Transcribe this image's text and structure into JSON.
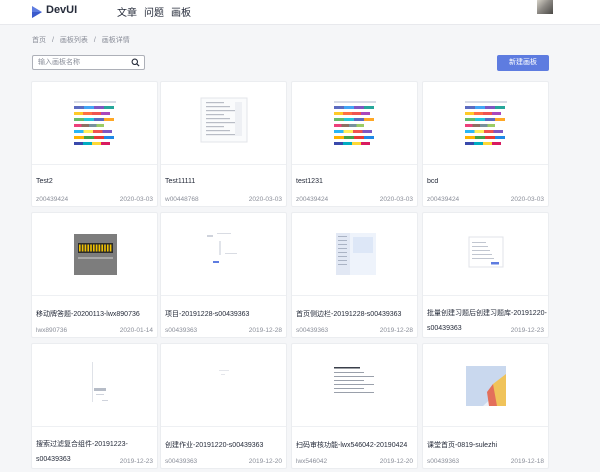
{
  "header": {
    "brand": "DevUI",
    "nav": [
      "文章",
      "问题",
      "画板"
    ]
  },
  "breadcrumb": [
    "首页",
    "/",
    "画板列表",
    "/",
    "画板详情"
  ],
  "search": {
    "placeholder": "输入画板名称",
    "value": ""
  },
  "toolbar": {
    "new_board_label": "新建画板"
  },
  "boards": [
    {
      "title": "Test2",
      "author": "z00439424",
      "date": "2020-03-03",
      "thumb": "palette"
    },
    {
      "title": "Test11111",
      "author": "w00448768",
      "date": "2020-03-03",
      "thumb": "table"
    },
    {
      "title": "test1231",
      "author": "z00439424",
      "date": "2020-03-03",
      "thumb": "palette"
    },
    {
      "title": "bcd",
      "author": "z00439424",
      "date": "2020-03-03",
      "thumb": "palette"
    },
    {
      "title": "移动牌答题-20200113-lwx890736",
      "author": "lwx890736",
      "date": "2020-01-14",
      "thumb": "dark"
    },
    {
      "title": "项目-20191228-s00439363",
      "author": "s00439363",
      "date": "2019-12-28",
      "thumb": "sketch"
    },
    {
      "title": "首页侧边栏-20191228-s00439363",
      "author": "s00439363",
      "date": "2019-12-28",
      "thumb": "page"
    },
    {
      "title": "批量创建习题后创建习题库-20191220-",
      "title_line2": "s00439363",
      "author": "",
      "date": "2019-12-23",
      "thumb": "dialog"
    },
    {
      "title": "搜索过滤复合组件-20191223-",
      "title_line2": "s00439363",
      "author": "",
      "date": "2019-12-23",
      "thumb": "sketch2"
    },
    {
      "title": "创建作业-20191220-s00439363",
      "author": "s00439363",
      "date": "2019-12-20",
      "thumb": "blank"
    },
    {
      "title": "扫码审核功能-lwx546042-20190424",
      "author": "lwx546042",
      "date": "2019-12-20",
      "thumb": "doc"
    },
    {
      "title": "课堂首页-0819-sulezhi",
      "author": "s00439363",
      "date": "2019-12-18",
      "thumb": "photo"
    }
  ]
}
